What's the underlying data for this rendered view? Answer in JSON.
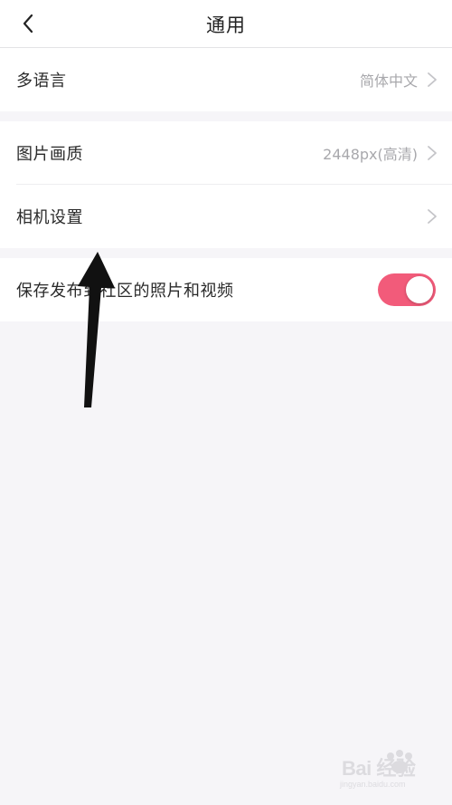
{
  "nav": {
    "title": "通用",
    "back_icon": "chevron-left-icon"
  },
  "settings": {
    "language": {
      "label": "多语言",
      "value": "简体中文"
    },
    "image_quality": {
      "label": "图片画质",
      "value": "2448px(高清)"
    },
    "camera_settings": {
      "label": "相机设置"
    },
    "save_media": {
      "label": "保存发布到社区的照片和视频",
      "enabled": true
    }
  },
  "colors": {
    "accent": "#f25b7a",
    "background": "#f6f5f8",
    "row_background": "#ffffff",
    "value_text": "#a8a8ac",
    "chevron": "#c4c4c8"
  },
  "watermark": {
    "text": "Bai 经验",
    "sub": "jingyan.baidu.com"
  }
}
